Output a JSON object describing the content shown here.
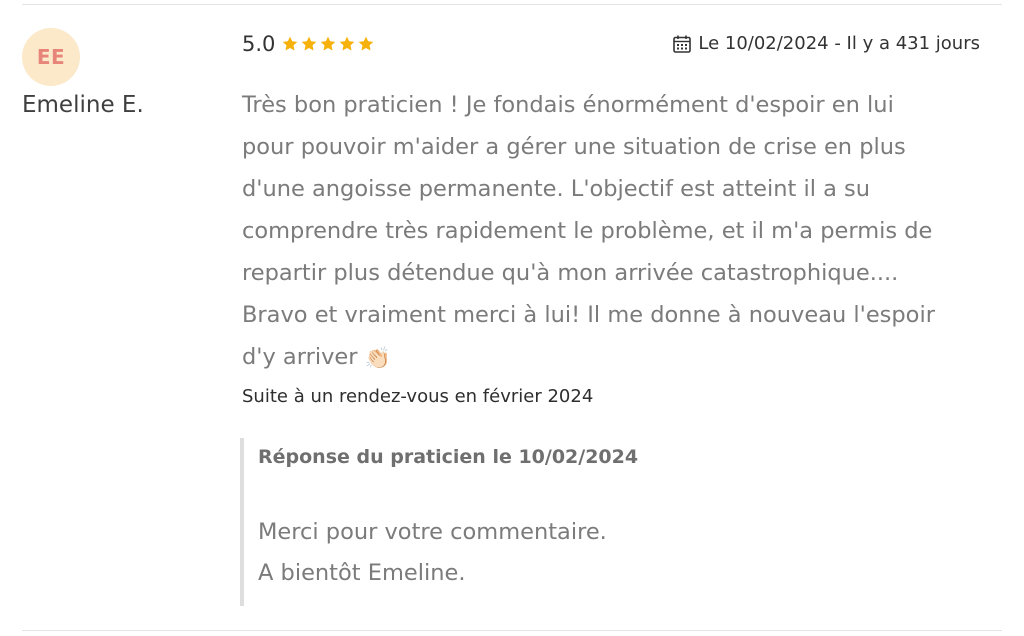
{
  "review": {
    "avatar_initials": "EE",
    "author_name": "Emeline E.",
    "rating_value": "5.0",
    "rating_stars": 5,
    "star_color": "#f6b20a",
    "date_text": "Le 10/02/2024 - Il y a 431 jours",
    "comment_lines": [
      "Très bon praticien ! Je fondais énormément d'espoir en lui",
      "pour pouvoir m'aider a gérer une situation de crise en plus",
      "d'une angoisse permanente. L'objectif est atteint il a su",
      "comprendre très rapidement le problème, et il m'a permis de",
      "repartir plus détendue qu'à mon arrivée catastrophique....",
      "Bravo et vraiment merci à lui! Il me donne à nouveau l'espoir",
      "d'y arriver"
    ],
    "comment_emoji": "👏🏻",
    "appointment_text": "Suite à un rendez-vous en février 2024"
  },
  "reply": {
    "title": "Réponse du praticien le 10/02/2024",
    "lines": [
      "Merci pour votre commentaire.",
      "A bientôt Emeline."
    ]
  },
  "colors": {
    "avatar_bg": "#fbe9c9",
    "avatar_text": "#e8857a",
    "body_text": "#7b7b7b",
    "reply_border": "#dedede"
  },
  "icons": {
    "calendar": "calendar-icon",
    "star": "star-icon",
    "emoji": "clapping-hands-icon"
  }
}
